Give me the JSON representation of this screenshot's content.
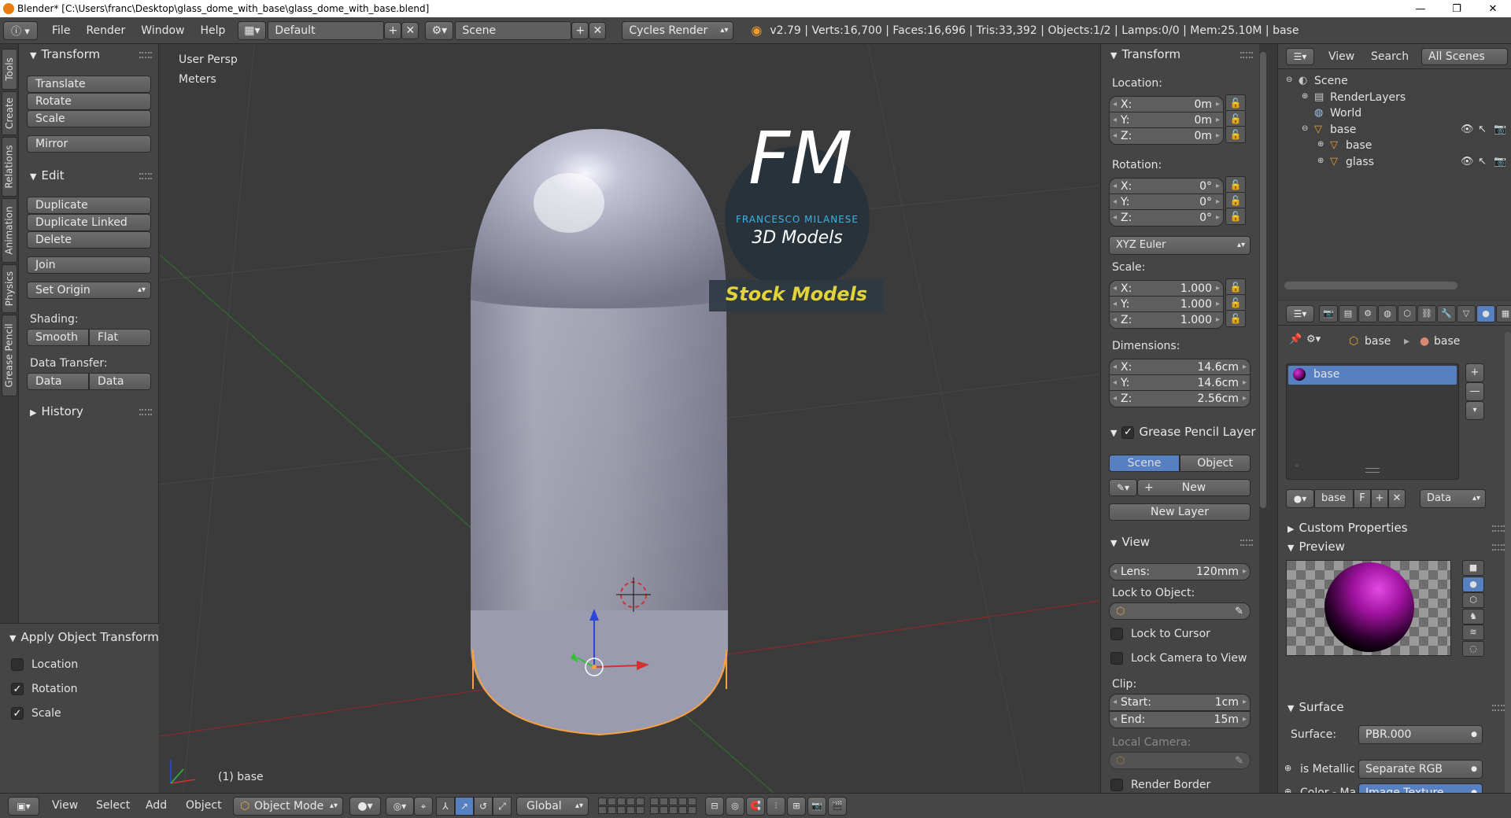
{
  "window": {
    "title": "Blender* [C:\\Users\\franc\\Desktop\\glass_dome_with_base\\glass_dome_with_base.blend]",
    "minimize": "—",
    "maximize": "❐",
    "close": "✕"
  },
  "infobar": {
    "menus": [
      "File",
      "Render",
      "Window",
      "Help"
    ],
    "layout": "Default",
    "scene": "Scene",
    "engine": "Cycles Render",
    "stats": "v2.79 | Verts:16,700 | Faces:16,696 | Tris:33,392 | Objects:1/2 | Lamps:0/0 | Mem:25.10M | base"
  },
  "tabs": [
    "Tools",
    "Create",
    "Relations",
    "Animation",
    "Physics",
    "Grease Pencil"
  ],
  "toolshelf": {
    "transform_title": "Transform",
    "transform_buttons": [
      "Translate",
      "Rotate",
      "Scale"
    ],
    "mirror": "Mirror",
    "edit_title": "Edit",
    "edit_buttons": [
      "Duplicate",
      "Duplicate Linked",
      "Delete"
    ],
    "join": "Join",
    "set_origin": "Set Origin",
    "shading_label": "Shading:",
    "smooth": "Smooth",
    "flat": "Flat",
    "data_transfer_label": "Data Transfer:",
    "data": "Data",
    "data_layo": "Data Layo",
    "history_title": "History",
    "apply_title": "Apply Object Transform",
    "apply_location": {
      "label": "Location",
      "checked": false
    },
    "apply_rotation": {
      "label": "Rotation",
      "checked": true
    },
    "apply_scale": {
      "label": "Scale",
      "checked": true
    }
  },
  "viewport": {
    "view_name": "User Persp",
    "units": "Meters",
    "object_label": "(1) base",
    "overlay": {
      "initials": "FM",
      "author": "FRANCESCO MILANESE",
      "subtitle": "3D Models",
      "banner": "Stock Models"
    }
  },
  "npanel": {
    "transform_title": "Transform",
    "location_label": "Location:",
    "location": [
      {
        "k": "X:",
        "v": "0m"
      },
      {
        "k": "Y:",
        "v": "0m"
      },
      {
        "k": "Z:",
        "v": "0m"
      }
    ],
    "rotation_label": "Rotation:",
    "rotation": [
      {
        "k": "X:",
        "v": "0°"
      },
      {
        "k": "Y:",
        "v": "0°"
      },
      {
        "k": "Z:",
        "v": "0°"
      }
    ],
    "rotation_mode": "XYZ Euler",
    "scale_label": "Scale:",
    "scale": [
      {
        "k": "X:",
        "v": "1.000"
      },
      {
        "k": "Y:",
        "v": "1.000"
      },
      {
        "k": "Z:",
        "v": "1.000"
      }
    ],
    "dimensions_label": "Dimensions:",
    "dimensions": [
      {
        "k": "X:",
        "v": "14.6cm"
      },
      {
        "k": "Y:",
        "v": "14.6cm"
      },
      {
        "k": "Z:",
        "v": "2.56cm"
      }
    ],
    "gp_title": "Grease Pencil Layer",
    "gp_scene": "Scene",
    "gp_object": "Object",
    "gp_new": "New",
    "gp_new_layer": "New Layer",
    "view_title": "View",
    "lens_label": "Lens:",
    "lens_value": "120mm",
    "lock_object_label": "Lock to Object:",
    "lock_cursor": "Lock to Cursor",
    "lock_camera": "Lock Camera to View",
    "clip_label": "Clip:",
    "clip_start_label": "Start:",
    "clip_start": "1cm",
    "clip_end_label": "End:",
    "clip_end": "15m",
    "local_camera": "Local Camera:",
    "render_border": "Render Border"
  },
  "outliner": {
    "view": "View",
    "search": "Search",
    "filter": "All Scenes",
    "tree": [
      {
        "label": "Scene",
        "depth": 0
      },
      {
        "label": "RenderLayers",
        "depth": 1
      },
      {
        "label": "World",
        "depth": 1
      },
      {
        "label": "base",
        "depth": 1
      },
      {
        "label": "base",
        "depth": 2
      },
      {
        "label": "glass",
        "depth": 2
      }
    ]
  },
  "properties": {
    "breadcrumb_object": "base",
    "breadcrumb_material": "base",
    "slot_name": "base",
    "material_name": "base",
    "fake_user": "F",
    "link": "Data",
    "custom_props": "Custom Properties",
    "preview": "Preview",
    "surface_title": "Surface",
    "surface_label": "Surface:",
    "surface_value": "PBR.000",
    "metallic_label": "is Metallic",
    "metallic_value": "Separate RGB",
    "color_label": "Color - Ma",
    "color_value": "Image Texture"
  },
  "bottombar": {
    "view": "View",
    "select": "Select",
    "add": "Add",
    "object": "Object",
    "mode": "Object Mode",
    "orientation": "Global"
  },
  "colors": {
    "accent": "#5680c2",
    "selection": "#f5a142",
    "material": "#a012a0"
  }
}
